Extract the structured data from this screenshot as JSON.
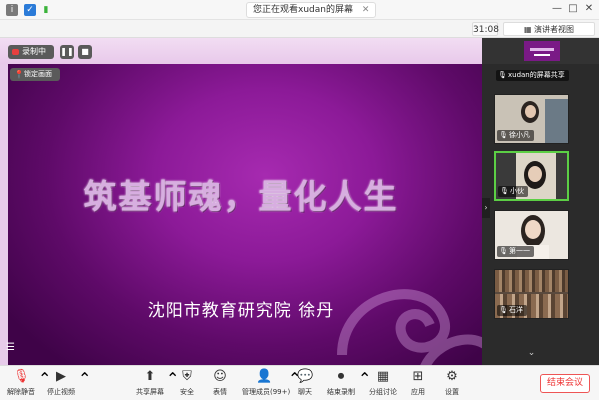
{
  "titlebar": {
    "center_text": "您正在观看xudan的屏幕",
    "close_glyph": "✕",
    "min_glyph": "—",
    "max_glyph": "□",
    "close_win_glyph": "✕"
  },
  "subbar": {
    "time": "31:08",
    "view_label": "演讲者视图"
  },
  "slide": {
    "recording_label": "录制中",
    "pause_glyph": "❚❚",
    "stop_glyph": "■",
    "lock_label": "锁定画面",
    "title": "筑基师魂，量化人生",
    "subtitle": "沈阳市教育研究院   徐丹"
  },
  "participants": [
    {
      "name": "xudan的屏幕共享"
    },
    {
      "name": "徐小凡"
    },
    {
      "name": "小伙"
    },
    {
      "name": "第一一"
    },
    {
      "name": "石洋"
    }
  ],
  "toolbar": {
    "mute": "解除静音",
    "video": "停止视频",
    "share": "共享屏幕",
    "security": "安全",
    "reactions": "表情",
    "participants": "管理成员(99+)",
    "chat": "聊天",
    "record": "结束录制",
    "breakout": "分组讨论",
    "apps": "应用",
    "settings": "设置",
    "end": "结束会议"
  },
  "colors": {
    "accent_red": "#e33333",
    "active_speaker": "#5ccf45",
    "slide_purple": "#8c1a98"
  }
}
